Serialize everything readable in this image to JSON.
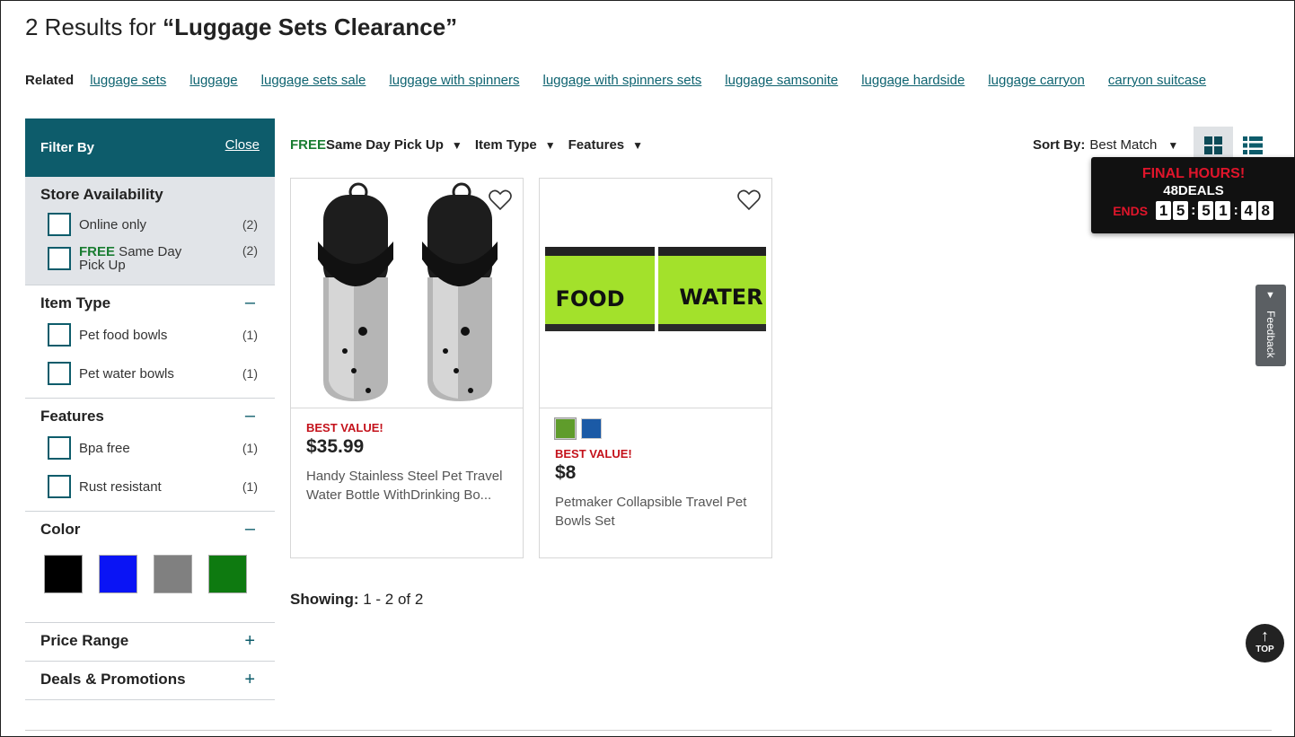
{
  "header": {
    "count_text": "2 Results for ",
    "query": "“Luggage Sets Clearance”"
  },
  "related": {
    "label": "Related",
    "links": [
      "luggage sets",
      "luggage",
      "luggage sets sale",
      "luggage with spinners",
      "luggage with spinners sets",
      "luggage samsonite",
      "luggage hardside",
      "luggage carryon",
      "carryon suitcase"
    ]
  },
  "filter": {
    "title": "Filter By",
    "close": "Close",
    "store": {
      "title": "Store Availability",
      "online_label": "Online only",
      "online_count": "(2)",
      "free_prefix": "FREE",
      "sameday_label": " Same Day Pick Up",
      "sameday_count": "(2)"
    },
    "item_type": {
      "title": "Item Type",
      "toggle": "–",
      "options": [
        {
          "label": "Pet food bowls",
          "count": "(1)"
        },
        {
          "label": "Pet water bowls",
          "count": "(1)"
        }
      ]
    },
    "features": {
      "title": "Features",
      "toggle": "–",
      "options": [
        {
          "label": "Bpa free",
          "count": "(1)"
        },
        {
          "label": "Rust resistant",
          "count": "(1)"
        }
      ]
    },
    "color": {
      "title": "Color",
      "toggle": "–",
      "swatches": [
        "#000000",
        "#0a14f5",
        "#808080",
        "#0e7a10"
      ]
    },
    "price_range": {
      "title": "Price Range",
      "toggle": "+"
    },
    "deals": {
      "title": "Deals & Promotions",
      "toggle": "+"
    }
  },
  "toolbar": {
    "free": "FREE",
    "sameday": " Same Day Pick Up",
    "item_type": "Item Type",
    "features": "Features",
    "arrow": "▼",
    "sort_label": "Sort By:",
    "sort_value": "Best Match"
  },
  "deals_banner": {
    "line1": "FINAL HOURS!",
    "line2": "48DEALS",
    "ends": "ENDS",
    "d": [
      "1",
      "5",
      "5",
      "1",
      "4",
      "8"
    ]
  },
  "products": [
    {
      "badge": "BEST VALUE!",
      "price": "$35.99",
      "name": "Handy Stainless Steel Pet Travel Water Bottle WithDrinking Bo..."
    },
    {
      "badge": "BEST VALUE!",
      "price": "$8",
      "name": "Petmaker Collapsible Travel Pet Bowls Set",
      "colors": [
        "#5f9c2b",
        "#1b5aa6"
      ],
      "img_text_left": "FOOD",
      "img_text_right": "WATER"
    }
  ],
  "showing": {
    "label": "Showing:",
    "value": " 1 - 2 of 2"
  },
  "feedback": {
    "label": "Feedback"
  },
  "top_button": {
    "label": "TOP"
  },
  "colors": {
    "brand_teal": "#0d5c6b",
    "link": "#0e6370",
    "badge_red": "#c4121b",
    "free_green": "#1a7d32"
  }
}
